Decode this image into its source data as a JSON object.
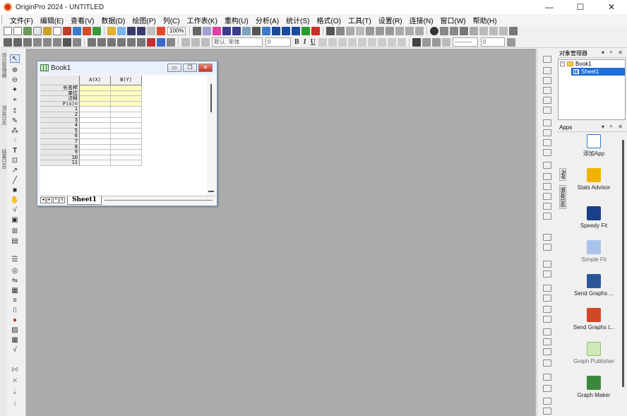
{
  "window": {
    "title": "OriginPro 2024 - UNTITLED",
    "minimize": "—",
    "maximize": "☐",
    "close": "✕"
  },
  "menu": [
    {
      "label": "文件(F)"
    },
    {
      "label": "编辑(E)"
    },
    {
      "label": "查看(V)"
    },
    {
      "label": "数据(D)"
    },
    {
      "label": "绘图(P)"
    },
    {
      "label": "列(C)"
    },
    {
      "label": "工作表(K)"
    },
    {
      "label": "重构(U)"
    },
    {
      "label": "分析(A)"
    },
    {
      "label": "统计(S)"
    },
    {
      "label": "格式(O)"
    },
    {
      "label": "工具(T)"
    },
    {
      "label": "设置(R)"
    },
    {
      "label": "连接(N)"
    },
    {
      "label": "窗口(W)"
    },
    {
      "label": "帮助(H)"
    }
  ],
  "toolbar": {
    "zoom": "100%",
    "font_name": "默认: 宋体",
    "font_size": "0",
    "bold": "B",
    "italic": "I",
    "underline": "U",
    "line_width": "0"
  },
  "left_toolbar": {
    "strip_labels": [
      "项目管理器",
      "消息日志",
      "结果日志"
    ]
  },
  "book": {
    "name": "Book1",
    "col_a": "A(X)",
    "col_b": "B(Y)",
    "label_rows": [
      "长名称",
      "单位",
      "注释",
      "F(x)="
    ],
    "data_rows": [
      "1",
      "2",
      "3",
      "4",
      "5",
      "6",
      "7",
      "8",
      "9",
      "10",
      "11"
    ],
    "sheet_tab": "Sheet1",
    "nav_buttons": [
      "◂",
      "▸",
      "+",
      "∨"
    ]
  },
  "object_manager": {
    "title": "对象管理器",
    "book": "Book1",
    "sheet": "Sheet1"
  },
  "apps_panel": {
    "title": "Apps",
    "side_tabs": [
      "App",
      "消息日志"
    ],
    "items": [
      {
        "name": "添加App",
        "color": "#2e7bd6",
        "dim": false
      },
      {
        "name": "Stats Advisor",
        "color": "#f0b400",
        "dim": false
      },
      {
        "name": "Speedy Fit",
        "color": "#1a3f8a",
        "dim": false
      },
      {
        "name": "Simple Fit",
        "color": "#a9c3ec",
        "dim": true
      },
      {
        "name": "Send Graphs ...",
        "color": "#2b579a",
        "dim": false
      },
      {
        "name": "Send Graphs t...",
        "color": "#d24726",
        "dim": false
      },
      {
        "name": "Graph Publisher",
        "color": "#8fc26a",
        "dim": true
      },
      {
        "name": "Graph Maker",
        "color": "#3b8a3b",
        "dim": false
      }
    ]
  }
}
